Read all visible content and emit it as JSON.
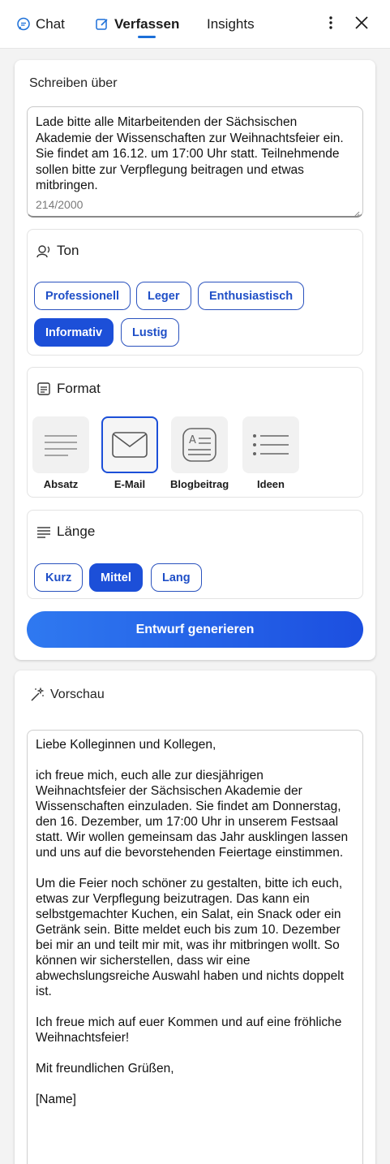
{
  "header": {
    "tabs": [
      {
        "label": "Chat",
        "icon": "chat-icon"
      },
      {
        "label": "Verfassen",
        "icon": "compose-icon",
        "active": true
      },
      {
        "label": "Insights"
      }
    ],
    "accent": "#1b6fd8"
  },
  "compose": {
    "write_about_label": "Schreiben über",
    "prompt_text": "Lade bitte alle Mitarbeitenden der Sächsischen Akademie der Wissenschaften zur Weihnachtsfeier ein. Sie findet am 16.12. um 17:00 Uhr statt. Teilnehmende sollen bitte zur Verpflegung beitragen und etwas mitbringen.",
    "char_count": "214/2000",
    "tone": {
      "title": "Ton",
      "options": [
        "Professionell",
        "Leger",
        "Enthusiastisch",
        "Informativ",
        "Lustig"
      ],
      "selected": "Informativ"
    },
    "format": {
      "title": "Format",
      "options": [
        "Absatz",
        "E-Mail",
        "Blogbeitrag",
        "Ideen"
      ],
      "selected": "E-Mail"
    },
    "length": {
      "title": "Länge",
      "options": [
        "Kurz",
        "Mittel",
        "Lang"
      ],
      "selected": "Mittel"
    },
    "generate_label": "Entwurf generieren"
  },
  "preview": {
    "title": "Vorschau",
    "paragraphs": [
      "Liebe Kolleginnen und Kollegen,",
      "ich freue mich, euch alle zur diesjährigen Weihnachtsfeier der Sächsischen Akademie der Wissenschaften einzuladen. Sie findet am Donnerstag, den 16. Dezember, um 17:00 Uhr in unserem Festsaal statt. Wir wollen gemeinsam das Jahr ausklingen lassen und uns auf die bevorstehenden Feiertage einstimmen.",
      "Um die Feier noch schöner zu gestalten, bitte ich euch, etwas zur Verpflegung beizutragen. Das kann ein selbstgemachter Kuchen, ein Salat, ein Snack oder ein Getränk sein. Bitte meldet euch bis zum 10. Dezember bei mir an und teilt mir mit, was ihr mitbringen wollt. So können wir sicherstellen, dass wir eine abwechslungsreiche Auswahl haben und nichts doppelt ist.",
      "Ich freue mich auf euer Kommen und auf eine fröhliche Weihnachtsfeier!",
      "Mit freundlichen Grüßen,",
      "[Name]"
    ]
  }
}
